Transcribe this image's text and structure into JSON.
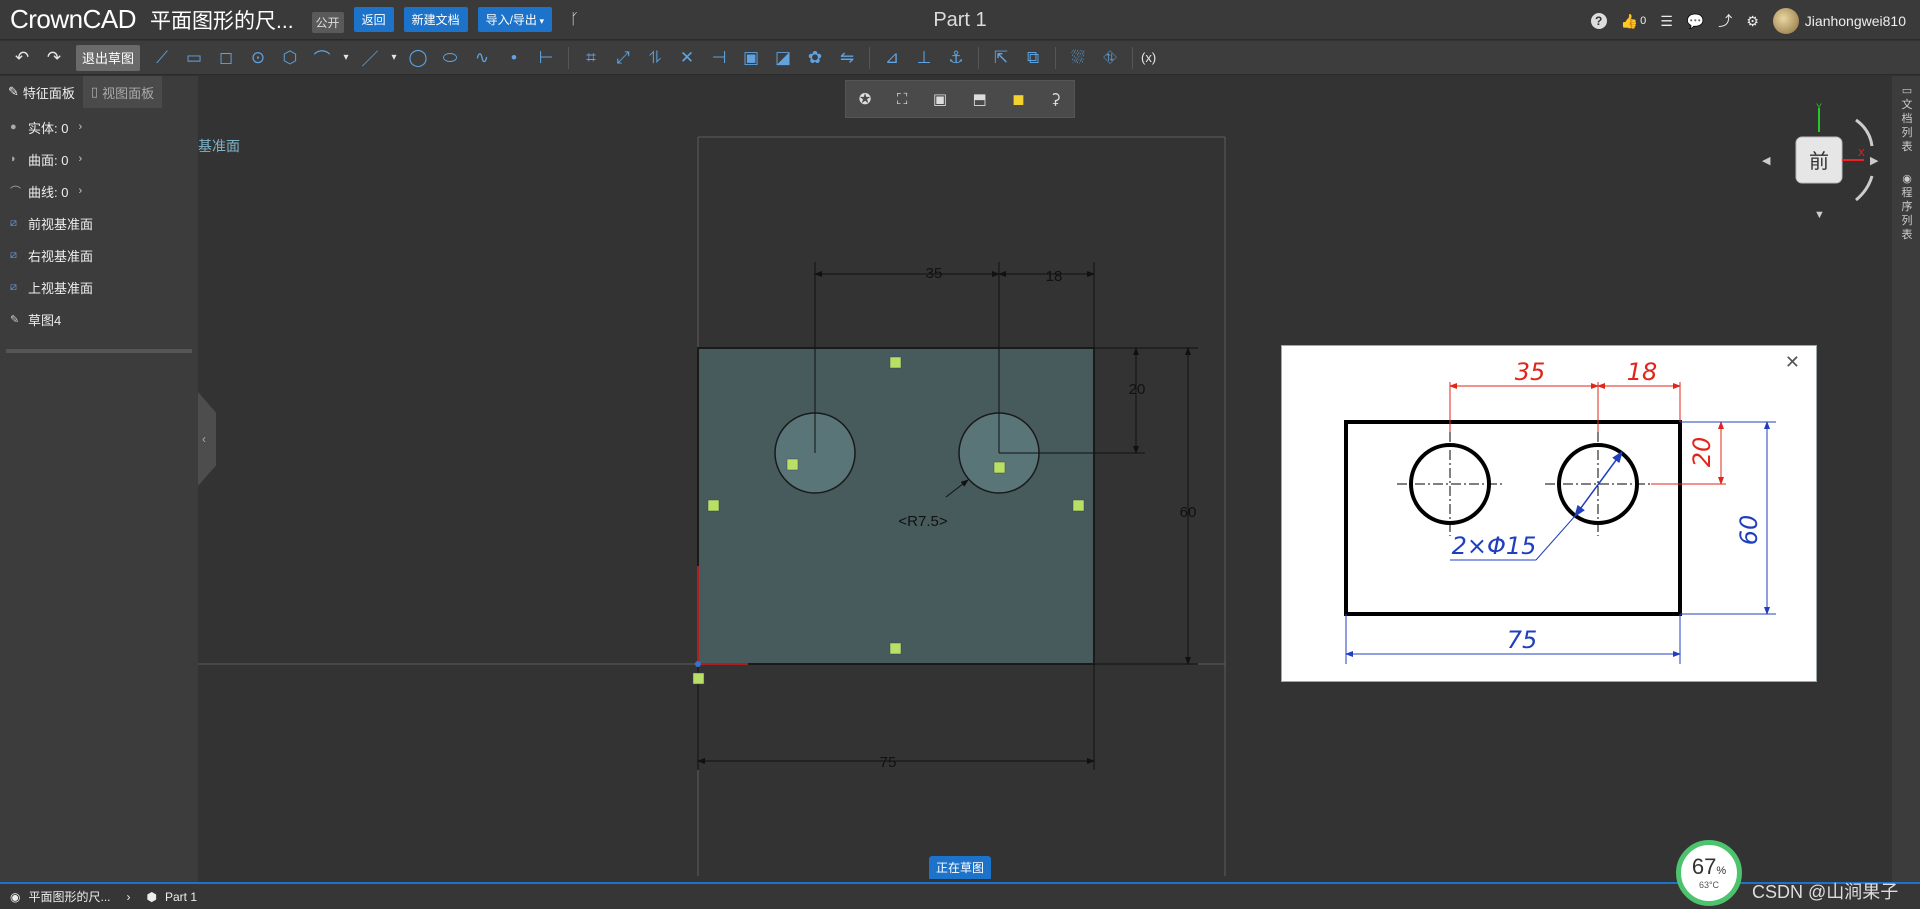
{
  "header": {
    "logo": "CrownCAD",
    "doc_title": "平面图形的尺...",
    "visibility": "公开",
    "back_label": "返回",
    "new_doc_label": "新建文档",
    "import_export_label": "导入/导出",
    "part_title": "Part 1",
    "like_count": "0",
    "username": "Jianhongwei810"
  },
  "toolbar": {
    "exit_sketch_label": "退出草图",
    "variables_label": "(x)"
  },
  "left_panel": {
    "tab_feature": "特征面板",
    "tab_view": "视图面板",
    "items": [
      {
        "label": "实体: 0",
        "icon": "solid-icon"
      },
      {
        "label": "曲面: 0",
        "icon": "surface-icon"
      },
      {
        "label": "曲线: 0",
        "icon": "curve-icon"
      },
      {
        "label": "前视基准面",
        "icon": "plane-icon"
      },
      {
        "label": "右视基准面",
        "icon": "plane-icon"
      },
      {
        "label": "上视基准面",
        "icon": "plane-icon"
      },
      {
        "label": "草图4",
        "icon": "sketch-icon"
      }
    ]
  },
  "canvas": {
    "plane_label": "基准面",
    "dims": {
      "d35": "35",
      "d18": "18",
      "d20": "20",
      "d60": "60",
      "d75": "75",
      "radius": "<R7.5>"
    }
  },
  "viewcube": {
    "face": "前",
    "axis_y": "Y",
    "axis_x": "X"
  },
  "reference": {
    "d35": "35",
    "d18": "18",
    "d20": "20",
    "d60": "60",
    "d75": "75",
    "holes": "2×Φ15"
  },
  "right_strip": {
    "doc_list": "文档列表",
    "program_list": "程序列表"
  },
  "status": {
    "sketching": "正在草图",
    "crumb1": "平面图形的尺...",
    "crumb2": "Part 1",
    "perf_pct": "67",
    "perf_temp": "63°C",
    "watermark": "CSDN @山涧果子"
  },
  "colors": {
    "accent": "#1c73c9",
    "sketch_fill": "#4a5c5e",
    "ref_red": "#e0261c",
    "ref_blue": "#1f3fbf"
  }
}
